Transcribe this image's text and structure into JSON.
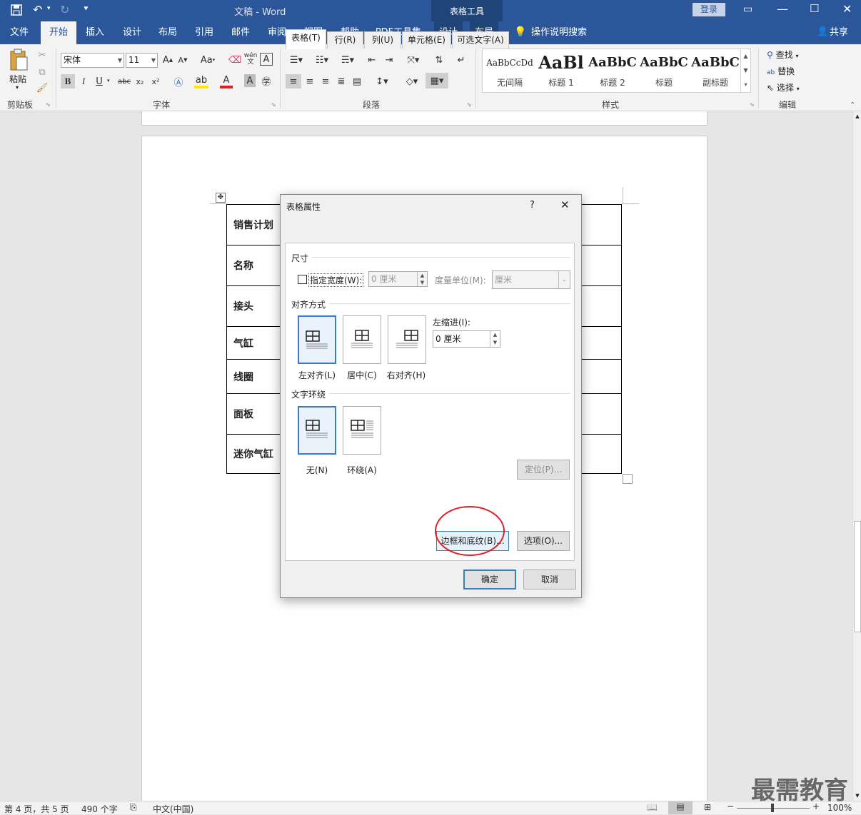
{
  "window": {
    "doc_title": "文稿",
    "separator": "-",
    "app_name": "Word",
    "context_tool": "表格工具",
    "login": "登录",
    "share": "共享"
  },
  "tabs": [
    "文件",
    "开始",
    "插入",
    "设计",
    "布局",
    "引用",
    "邮件",
    "审阅",
    "视图",
    "帮助",
    "PDF工具集",
    "设计",
    "布局"
  ],
  "tell_me": "操作说明搜索",
  "ribbon": {
    "clipboard": {
      "paste": "粘贴",
      "label": "剪贴板"
    },
    "font": {
      "name": "宋体",
      "size": "11",
      "label": "字体",
      "aa": "Aa",
      "bold": "B",
      "italic": "I",
      "underline": "U",
      "strike": "abc",
      "sub": "x₂",
      "sup": "x²",
      "char_A": "A",
      "wen": "wén"
    },
    "paragraph": {
      "label": "段落"
    },
    "styles": {
      "label": "样式",
      "items": [
        {
          "sample": "AaBbCcDd",
          "name": "无间隔"
        },
        {
          "sample": "AaBl",
          "name": "标题 1"
        },
        {
          "sample": "AaBbC",
          "name": "标题 2"
        },
        {
          "sample": "AaBbC",
          "name": "标题"
        },
        {
          "sample": "AaBbC",
          "name": "副标题"
        }
      ]
    },
    "editing": {
      "find": "查找",
      "replace": "替换",
      "select": "选择",
      "label": "编辑"
    }
  },
  "document": {
    "rows": [
      "销售计划",
      "名称",
      "接头",
      "气缸",
      "线圈",
      "面板",
      "迷你气缸"
    ]
  },
  "dialog": {
    "title": "表格属性",
    "help": "?",
    "close": "✕",
    "tabs": [
      "表格(T)",
      "行(R)",
      "列(U)",
      "单元格(E)",
      "可选文字(A)"
    ],
    "size_section": "尺寸",
    "specify_width": "指定宽度(W):",
    "width_value": "0 厘米",
    "measure_label": "度量单位(M):",
    "measure_value": "厘米",
    "alignment_section": "对齐方式",
    "align_options": [
      "左对齐(L)",
      "居中(C)",
      "右对齐(H)"
    ],
    "indent_label": "左缩进(I):",
    "indent_value": "0 厘米",
    "wrap_section": "文字环绕",
    "wrap_options": [
      "无(N)",
      "环绕(A)"
    ],
    "position_btn": "定位(P)...",
    "borders_btn": "边框和底纹(B)...",
    "options_btn": "选项(O)...",
    "ok": "确定",
    "cancel": "取消"
  },
  "status": {
    "page": "第 4 页，共 5 页",
    "words": "490 个字",
    "language": "中文(中国)",
    "zoom": "100%"
  },
  "watermark": "最需教育",
  "colors": {
    "brand": "#2b579a",
    "highlight_circle": "#e0202a",
    "selection": "#3a7bd5"
  }
}
